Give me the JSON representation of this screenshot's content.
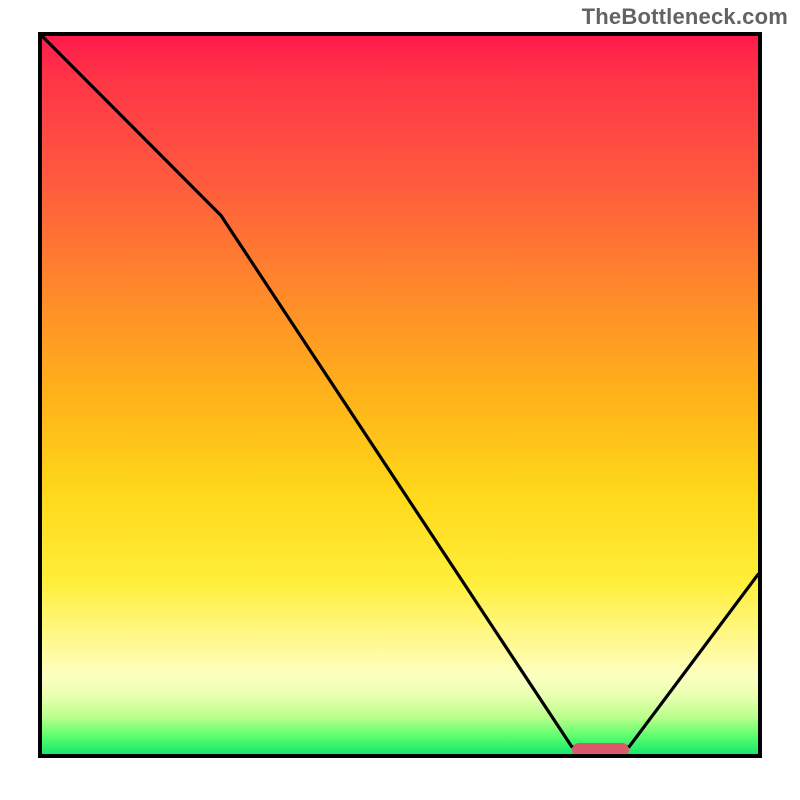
{
  "attribution": "TheBottleneck.com",
  "chart_data": {
    "type": "line",
    "title": "",
    "xlabel": "",
    "ylabel": "",
    "xlim": [
      0,
      100
    ],
    "ylim": [
      0,
      100
    ],
    "x": [
      0,
      25,
      74,
      82,
      100
    ],
    "values": [
      100,
      75,
      1,
      1,
      25
    ],
    "marker": {
      "x_start": 74,
      "x_end": 82,
      "y": 0.5
    },
    "gradient_stops": [
      {
        "pos": 0,
        "color": "#ff1a4b"
      },
      {
        "pos": 20,
        "color": "#ff5a3e"
      },
      {
        "pos": 50,
        "color": "#ffb21a"
      },
      {
        "pos": 76,
        "color": "#ffee3a"
      },
      {
        "pos": 92,
        "color": "#e8ffb0"
      },
      {
        "pos": 100,
        "color": "#17e86a"
      }
    ]
  },
  "plot": {
    "inner_width": 716,
    "inner_height": 718
  }
}
